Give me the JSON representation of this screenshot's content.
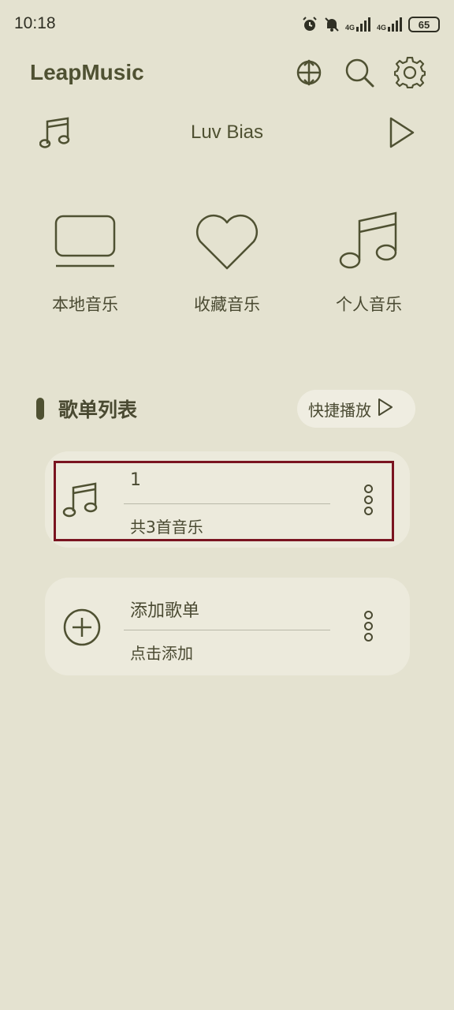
{
  "status_bar": {
    "time": "10:18",
    "network_1": "4G",
    "network_2": "4G",
    "battery": "65",
    "icons": [
      "alarm-icon",
      "mute-icon",
      "signal-icon",
      "signal-icon",
      "battery-icon"
    ]
  },
  "header": {
    "title": "LeapMusic",
    "actions": [
      "expand-icon",
      "search-icon",
      "gear-icon"
    ]
  },
  "now_playing": {
    "title": "Luv Bias"
  },
  "categories": [
    {
      "label": "本地音乐",
      "icon": "monitor-icon"
    },
    {
      "label": "收藏音乐",
      "icon": "heart-icon"
    },
    {
      "label": "个人音乐",
      "icon": "music-note-icon"
    }
  ],
  "playlist_section": {
    "title": "歌单列表",
    "quick_play_label": "快捷播放"
  },
  "playlists": [
    {
      "title": "1",
      "subtitle": "共3首音乐",
      "icon": "music-note-icon"
    },
    {
      "title": "添加歌单",
      "subtitle": "点击添加",
      "icon": "add-circle-icon"
    }
  ],
  "colors": {
    "background": "#e4e2d0",
    "card": "#eceadc",
    "accent": "#4f5132",
    "highlight": "#7a1420"
  }
}
